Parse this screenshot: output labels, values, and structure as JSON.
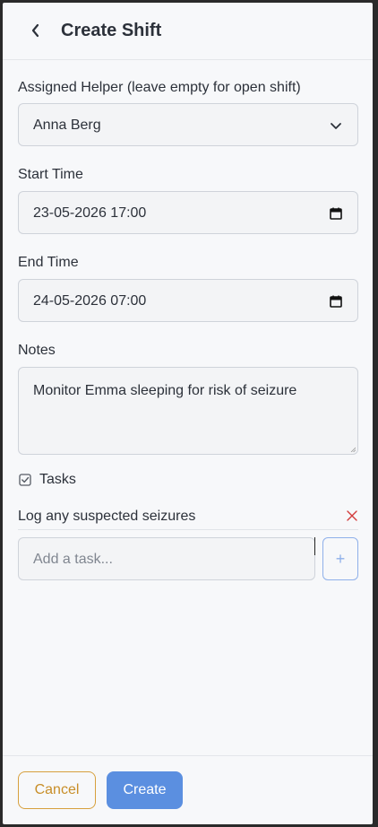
{
  "header": {
    "title": "Create Shift",
    "back_icon": "chevron-left-icon"
  },
  "form": {
    "helper": {
      "label": "Assigned Helper (leave empty for open shift)",
      "value": "Anna Berg",
      "icon": "chevron-down-icon"
    },
    "start_time": {
      "label": "Start Time",
      "value": "23-05-2026 17:00",
      "icon": "calendar-icon"
    },
    "end_time": {
      "label": "End Time",
      "value": "24-05-2026 07:00",
      "icon": "calendar-icon"
    },
    "notes": {
      "label": "Notes",
      "value": "Monitor Emma sleeping for risk of seizure"
    },
    "tasks": {
      "heading": "Tasks",
      "icon": "checkbox-icon",
      "items": [
        {
          "label": "Log any suspected seizures",
          "remove_icon": "close-icon",
          "remove_color": "#d23b3b"
        }
      ],
      "add_placeholder": "Add a task...",
      "add_button_label": "+"
    }
  },
  "footer": {
    "cancel_label": "Cancel",
    "create_label": "Create"
  },
  "colors": {
    "accent": "#5b8fe0",
    "cancel": "#c88e28",
    "danger": "#d23b3b"
  }
}
